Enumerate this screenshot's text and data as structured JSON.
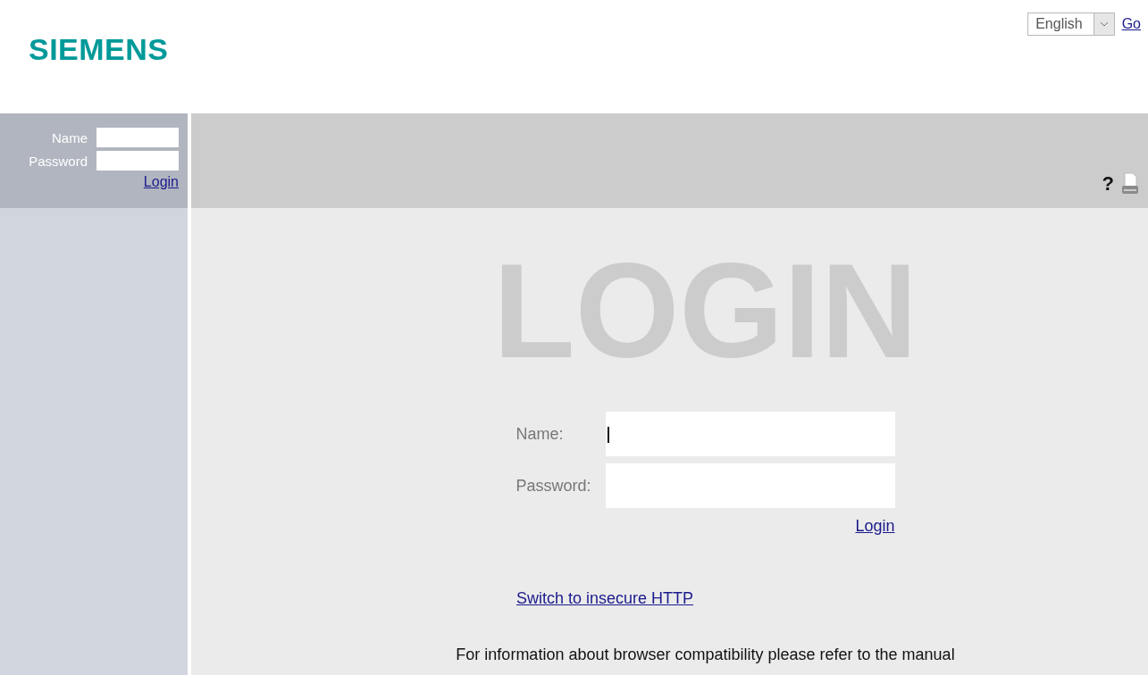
{
  "header": {
    "logo": "SIEMENS",
    "language": {
      "value": "English"
    },
    "go_link": "Go"
  },
  "sidebar_login": {
    "fields": [
      {
        "label": "Name"
      },
      {
        "label": "Password"
      }
    ],
    "login_link": "Login"
  },
  "toolbar": {
    "help": "?"
  },
  "main": {
    "title": "LOGIN",
    "fields": [
      {
        "label": "Name:",
        "focused": true
      },
      {
        "label": "Password:",
        "focused": false
      }
    ],
    "login_link": "Login",
    "switch_link": "Switch to insecure HTTP",
    "info": "For information about browser compatibility please refer to the manual"
  }
}
